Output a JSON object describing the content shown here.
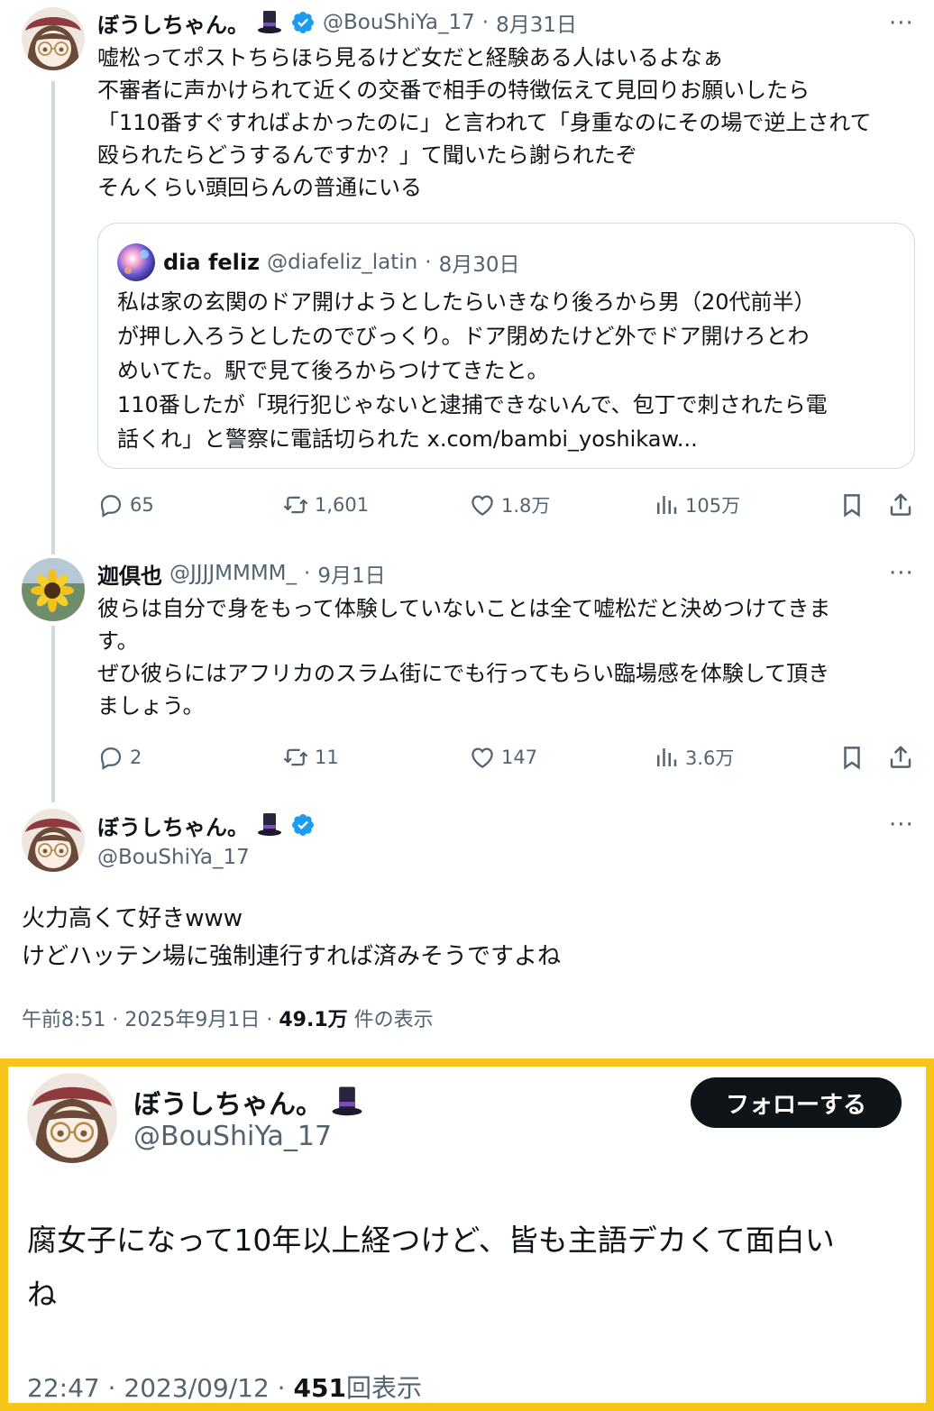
{
  "tweet1": {
    "name": "ぼうしちゃん。",
    "handle": "@BouShiYa_17",
    "date": "8月31日",
    "lines": [
      "嘘松ってポストちらほら見るけど女だと経験ある人はいるよなぁ",
      "不審者に声かけられて近くの交番で相手の特徴伝えて見回りお願いしたら",
      "「110番すぐすればよかったのに」と言われて「身重なのにその場で逆上されて",
      "殴られたらどうするんですか？」て聞いたら謝られたぞ",
      "そんくらい頭回らんの普通にいる"
    ],
    "quote": {
      "name": "dia feliz",
      "handle": "@diafeliz_latin",
      "date": "8月30日",
      "lines": [
        "私は家の玄関のドア開けようとしたらいきなり後ろから男（20代前半）",
        "が押し入ろうとしたのでびっくり。ドア閉めたけど外でドア開けろとわ",
        "めいてた。駅で見て後ろからつけてきたと。",
        "110番したが「現行犯じゃないと逮捕できないんで、包丁で刺されたら電",
        "話くれ」と警察に電話切られた x.com/bambi_yoshikaw..."
      ]
    },
    "replies": "65",
    "reposts": "1,601",
    "likes": "1.8万",
    "views": "105万"
  },
  "tweet2": {
    "name": "迦倶也",
    "handle": "@JJJJMMMM_",
    "date": "9月1日",
    "lines": [
      "彼らは自分で身をもって体験していないことは全て嘘松だと決めつけてきま",
      "す。",
      "ぜひ彼らにはアフリカのスラム街にでも行ってもらい臨場感を体験して頂き",
      "ましょう。"
    ],
    "replies": "2",
    "reposts": "11",
    "likes": "147",
    "views": "3.6万"
  },
  "tweet3": {
    "name": "ぼうしちゃん。",
    "handle": "@BouShiYa_17",
    "lines": [
      "火力高くて好きwww",
      "けどハッテン場に強制連行すれば済みそうですよね"
    ],
    "time": "午前8:51 · 2025年9月1日 · ",
    "view_count": "49.1万",
    "view_suffix": " 件の表示"
  },
  "embedded": {
    "name": "ぼうしちゃん。",
    "handle": "@BouShiYa_17",
    "follow_label": "フォローする",
    "lines": [
      "腐女子になって10年以上経つけど、皆も主語デカくて面白い",
      "ね"
    ],
    "time": "22:47 · 2023/09/12 · ",
    "view_count": "451",
    "view_suffix": "回表示"
  },
  "colors": {
    "text": "#0f1419",
    "muted": "#536471",
    "verified": "#1d9bf0",
    "highlight": "#f5c518",
    "line": "#cfd9de"
  }
}
